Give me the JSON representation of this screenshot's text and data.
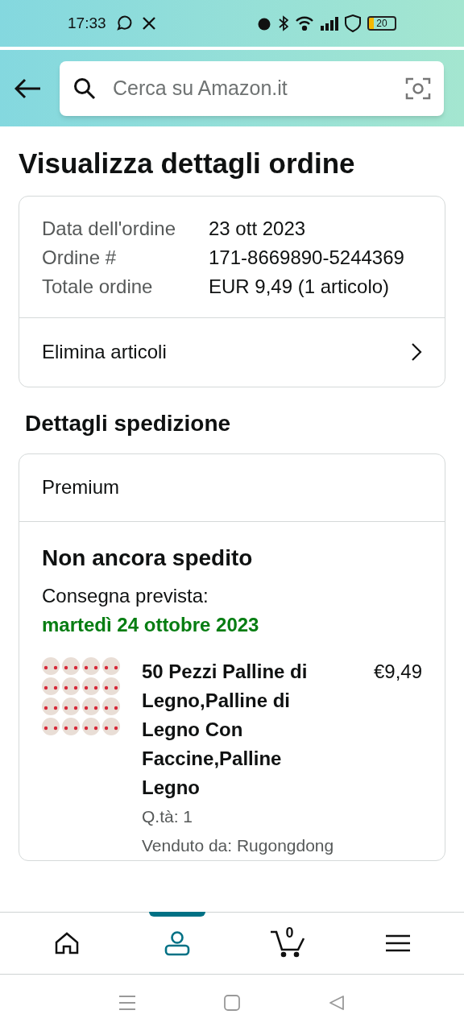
{
  "status_bar": {
    "time": "17:33",
    "battery": "20"
  },
  "search": {
    "placeholder": "Cerca su Amazon.it"
  },
  "title": "Visualizza dettagli ordine",
  "order_summary": {
    "rows": [
      {
        "label": "Data dell'ordine",
        "value": "23 ott 2023"
      },
      {
        "label": "Ordine #",
        "value": "171-8669890-5244369"
      },
      {
        "label": "Totale ordine",
        "value": "EUR 9,49 (1 articolo)"
      }
    ],
    "link": "Elimina articoli"
  },
  "shipping": {
    "heading": "Dettagli spedizione",
    "method": "Premium",
    "status": "Non ancora spedito",
    "delivery_label": "Consegna prevista:",
    "delivery_date": "martedì 24 ottobre 2023",
    "items": [
      {
        "title": "50 Pezzi Palline di Legno,Palline di Legno Con Faccine,Palline Legno",
        "price": "€9,49",
        "quantity": "Q.tà: 1",
        "seller": "Venduto da: Rugongdong"
      }
    ]
  },
  "bottom_nav": [
    {
      "kind": "home",
      "selected": false
    },
    {
      "kind": "account",
      "selected": true
    },
    {
      "kind": "cart",
      "selected": false,
      "count": "0"
    },
    {
      "kind": "menu",
      "selected": false
    }
  ]
}
